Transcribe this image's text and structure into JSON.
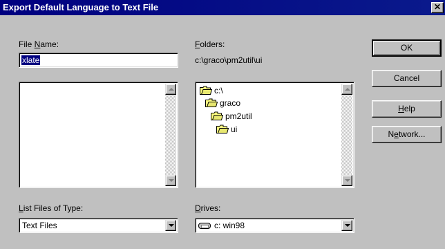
{
  "window": {
    "title": "Export Default Language to Text File",
    "close_glyph": "✕"
  },
  "file_name": {
    "label_pre": "File ",
    "label_key": "N",
    "label_post": "ame:",
    "value": "xlate"
  },
  "folders": {
    "label_key": "F",
    "label_post": "olders:",
    "current_path": "c:\\graco\\pm2util\\ui",
    "tree": [
      {
        "label": "c:\\",
        "icon": "open-folder-icon"
      },
      {
        "label": "graco",
        "icon": "open-folder-icon"
      },
      {
        "label": "pm2util",
        "icon": "open-folder-icon"
      },
      {
        "label": "ui",
        "icon": "open-folder-icon"
      }
    ]
  },
  "list_files_of_type": {
    "label_key": "L",
    "label_post": "ist Files of Type:",
    "selected": "Text Files"
  },
  "drives": {
    "label_key": "D",
    "label_post": "rives:",
    "selected": "c: win98",
    "icon": "hard-drive-icon"
  },
  "buttons": {
    "ok": "OK",
    "cancel": "Cancel",
    "help_key": "H",
    "help_post": "elp",
    "network_pre": "N",
    "network_key": "e",
    "network_post": "twork..."
  },
  "colors": {
    "title_bar": "#000080",
    "face": "#c0c0c0",
    "selection": "#000080"
  }
}
